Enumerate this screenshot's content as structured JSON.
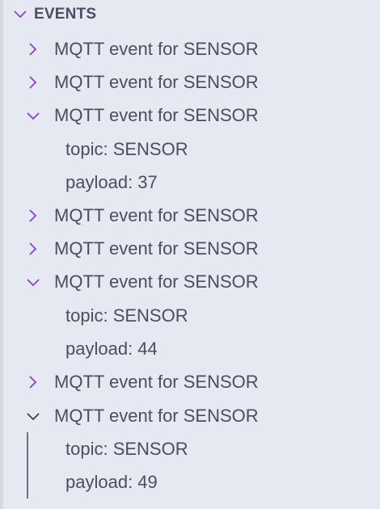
{
  "section": {
    "title": "EVENTS",
    "expanded": true
  },
  "items": [
    {
      "label": "MQTT event for SENSOR",
      "expanded": false
    },
    {
      "label": "MQTT event for SENSOR",
      "expanded": false
    },
    {
      "label": "MQTT event for SENSOR",
      "expanded": true,
      "children": [
        {
          "label": "topic: SENSOR"
        },
        {
          "label": "payload: 37"
        }
      ]
    },
    {
      "label": "MQTT event for SENSOR",
      "expanded": false
    },
    {
      "label": "MQTT event for SENSOR",
      "expanded": false
    },
    {
      "label": "MQTT event for SENSOR",
      "expanded": true,
      "children": [
        {
          "label": "topic: SENSOR"
        },
        {
          "label": "payload: 44"
        }
      ]
    },
    {
      "label": "MQTT event for SENSOR",
      "expanded": false
    },
    {
      "label": "MQTT event for SENSOR",
      "expanded": true,
      "focused": true,
      "children": [
        {
          "label": "topic: SENSOR"
        },
        {
          "label": "payload: 49"
        }
      ]
    }
  ],
  "colors": {
    "accent": "#8a3fd6",
    "focused_chevron": "#3a3e52",
    "background": "#e6e9f2",
    "text": "#4a4e62"
  }
}
